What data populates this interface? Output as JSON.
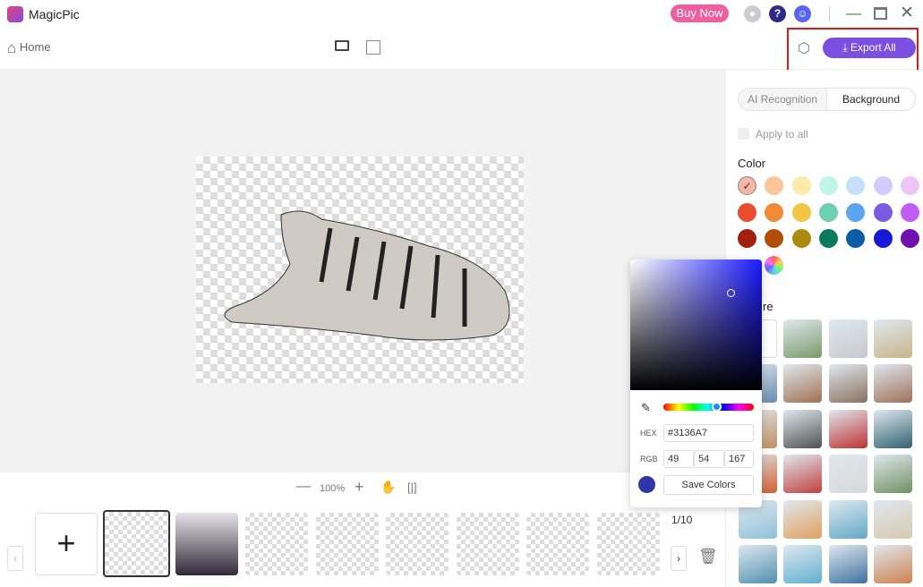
{
  "app": {
    "title": "MagicPic",
    "buy_now": "Buy Now",
    "help": "?"
  },
  "toolbar": {
    "home": "Home",
    "export_all": "Export All"
  },
  "zoom": {
    "level": "100%"
  },
  "filmstrip": {
    "counter": "1/10",
    "add": "+"
  },
  "panel": {
    "tabs": [
      {
        "label": "AI Recognition",
        "active": false
      },
      {
        "label": "Background",
        "active": true
      }
    ],
    "apply_to_all": "Apply to all",
    "apply_checked": false,
    "color_heading": "Color",
    "picture_heading_partial": "re",
    "swatches": [
      [
        "#f9b4a8",
        "#fbc79a",
        "#fde9a9",
        "#bff5e6",
        "#c5e0fb",
        "#d2cbfb",
        "#ecc6f6"
      ],
      [
        "#e84e2c",
        "#ef8a36",
        "#f4c542",
        "#6fcfb0",
        "#5aa5ee",
        "#7b5ce0",
        "#c05cf2"
      ],
      [
        "#a4200e",
        "#b24d06",
        "#a88a0c",
        "#0a7a5e",
        "#0c5ca8",
        "#1818d8",
        "#7010b0"
      ]
    ],
    "selected_swatch": "#f9b4a8",
    "pictures": [
      [
        "#e8e8e8",
        "#7a9a6a",
        "#c8c8d0",
        "#c9b48a"
      ],
      [
        "#6a8ab0",
        "#a07050",
        "#8a7060",
        "#a0705a"
      ],
      [
        "#c09060",
        "#505050",
        "#c03030",
        "#306070"
      ],
      [
        "#d06030",
        "#c04040",
        "#d8d8d8",
        "#709060"
      ],
      [
        "#90c0d8",
        "#e0a060",
        "#60a8c8",
        "#d8c8b0"
      ],
      [
        "#5090b0",
        "#60b0d0",
        "#4070a0",
        "#d08050"
      ]
    ]
  },
  "color_picker": {
    "hex_label": "HEX",
    "hex": "#3136A7",
    "rgb_label": "RGB",
    "r": "49",
    "g": "54",
    "b": "167",
    "save": "Save Colors",
    "hue": "#1a1aff",
    "hue_position": 0.64,
    "current": "#3136A7"
  },
  "colors": {
    "accent": "#7b4fe0",
    "buy": "#ef5fa0",
    "highlight_box": "#e01818"
  }
}
